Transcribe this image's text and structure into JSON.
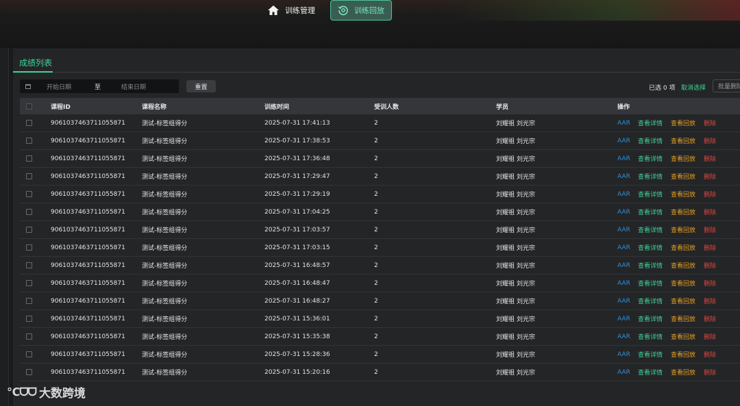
{
  "nav": {
    "home_label": "训练管理",
    "replay_label": "训练回放"
  },
  "panel": {
    "tab_label": "成绩列表"
  },
  "filters": {
    "start_placeholder": "开始日期",
    "to_label": "至",
    "end_placeholder": "结束日期",
    "reset_label": "重置",
    "selected_info": "已选 0 项",
    "cancel_selection": "取消选择",
    "batch_delete": "批量删除"
  },
  "table": {
    "headers": {
      "id": "课程ID",
      "name": "课程名称",
      "time": "训练时间",
      "count": "受训人数",
      "students": "学员",
      "ops": "操作"
    },
    "op_labels": {
      "aar": "AAR",
      "detail": "查看详情",
      "replay": "查看回放",
      "delete": "删除"
    },
    "rows": [
      {
        "id": "9061037463711055871",
        "name": "测试-标签组得分",
        "time": "2025-07-31 17:41:13",
        "count": "2",
        "students": "刘耀祖  刘光宗"
      },
      {
        "id": "9061037463711055871",
        "name": "测试-标签组得分",
        "time": "2025-07-31 17:38:53",
        "count": "2",
        "students": "刘耀祖  刘光宗"
      },
      {
        "id": "9061037463711055871",
        "name": "测试-标签组得分",
        "time": "2025-07-31 17:36:48",
        "count": "2",
        "students": "刘耀祖  刘光宗"
      },
      {
        "id": "9061037463711055871",
        "name": "测试-标签组得分",
        "time": "2025-07-31 17:29:47",
        "count": "2",
        "students": "刘耀祖  刘光宗"
      },
      {
        "id": "9061037463711055871",
        "name": "测试-标签组得分",
        "time": "2025-07-31 17:29:19",
        "count": "2",
        "students": "刘耀祖  刘光宗"
      },
      {
        "id": "9061037463711055871",
        "name": "测试-标签组得分",
        "time": "2025-07-31 17:04:25",
        "count": "2",
        "students": "刘耀祖  刘光宗"
      },
      {
        "id": "9061037463711055871",
        "name": "测试-标签组得分",
        "time": "2025-07-31 17:03:57",
        "count": "2",
        "students": "刘耀祖  刘光宗"
      },
      {
        "id": "9061037463711055871",
        "name": "测试-标签组得分",
        "time": "2025-07-31 17:03:15",
        "count": "2",
        "students": "刘耀祖  刘光宗"
      },
      {
        "id": "9061037463711055871",
        "name": "测试-标签组得分",
        "time": "2025-07-31 16:48:57",
        "count": "2",
        "students": "刘耀祖  刘光宗"
      },
      {
        "id": "9061037463711055871",
        "name": "测试-标签组得分",
        "time": "2025-07-31 16:48:47",
        "count": "2",
        "students": "刘耀祖  刘光宗"
      },
      {
        "id": "9061037463711055871",
        "name": "测试-标签组得分",
        "time": "2025-07-31 16:48:27",
        "count": "2",
        "students": "刘耀祖  刘光宗"
      },
      {
        "id": "9061037463711055871",
        "name": "测试-标签组得分",
        "time": "2025-07-31 15:36:01",
        "count": "2",
        "students": "刘耀祖  刘光宗"
      },
      {
        "id": "9061037463711055871",
        "name": "测试-标签组得分",
        "time": "2025-07-31 15:35:38",
        "count": "2",
        "students": "刘耀祖  刘光宗"
      },
      {
        "id": "9061037463711055871",
        "name": "测试-标签组得分",
        "time": "2025-07-31 15:28:36",
        "count": "2",
        "students": "刘耀祖  刘光宗"
      },
      {
        "id": "9061037463711055871",
        "name": "测试-标签组得分",
        "time": "2025-07-31 15:20:16",
        "count": "2",
        "students": "刘耀祖  刘光宗"
      }
    ]
  },
  "watermark": {
    "mark": "℃ᗜᗜ",
    "text": "大数跨境"
  },
  "colors": {
    "accent": "#3fd49a",
    "aar": "#2f8fd8",
    "replay": "#e8a020",
    "delete": "#e0443a"
  }
}
